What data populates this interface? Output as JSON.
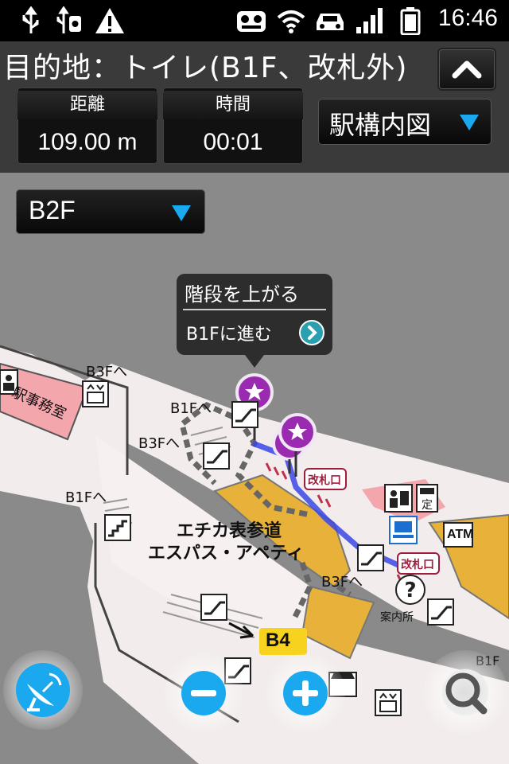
{
  "status_bar": {
    "time": "16:46",
    "icons": [
      "usb-icon",
      "usb-debug-icon",
      "warning-icon",
      "voicemail-icon",
      "wifi-icon",
      "car-icon",
      "signal-icon",
      "battery-icon"
    ]
  },
  "header": {
    "destination": "目的地：トイレ(B1F、改札外)",
    "distance_label": "距離",
    "distance_value": "109.00 m",
    "time_label": "時間",
    "time_value": "00:01",
    "map_select": "駅構内図"
  },
  "map": {
    "floor": "B2F",
    "tooltip_title": "階段を上がる",
    "tooltip_action": "B1Fに進む",
    "labels": {
      "station_office": "駅事務室",
      "b3f_1": "B3Fへ",
      "b1f_1": "B1Fへ",
      "b3f_2": "B3Fへ",
      "b1f_2": "B1Fへ",
      "echika_line1": "エチカ表参道",
      "echika_line2": "エスパス・アペティ",
      "b3f_3": "B3Fへ",
      "gate_1": "改札口",
      "gate_2": "改札口",
      "info": "案内所",
      "atm": "ATM",
      "exit": "B4",
      "b1f_3": "B1F"
    },
    "colors": {
      "accent": "#1aa8ee",
      "route": "#3a46e6",
      "pin": "#9a2ab0",
      "station_office": "#f4a6ad",
      "shop": "#e8b23a",
      "exit": "#f7d21e"
    }
  },
  "controls": {
    "gps": "satellite-dish-icon",
    "zoom_out": "zoom-out-icon",
    "zoom_in": "zoom-in-icon",
    "search": "search-icon"
  }
}
